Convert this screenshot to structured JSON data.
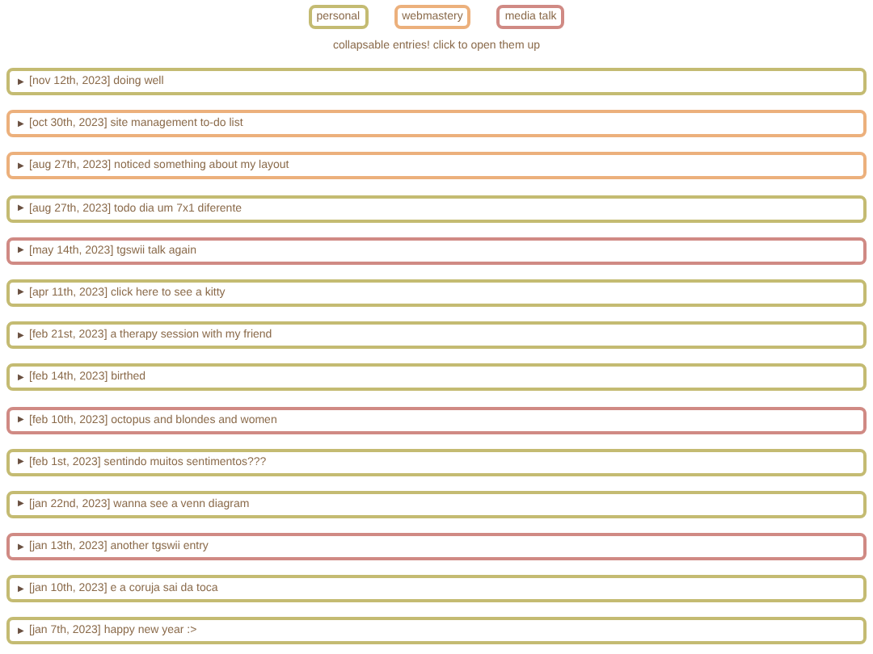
{
  "tags": [
    {
      "label": "personal",
      "color": "#c4bb72"
    },
    {
      "label": "webmastery",
      "color": "#ecb07c"
    },
    {
      "label": "media talk",
      "color": "#d08a84"
    }
  ],
  "subtitle": "collapsable entries! click to open them up",
  "entries": [
    {
      "marker": "▶",
      "title": "[nov 12th, 2023] doing well",
      "color": "#c4bb72",
      "expanded": false
    },
    {
      "marker": "▶",
      "title": "[oct 30th, 2023] site management to-do list",
      "color": "#ecb07c",
      "expanded": false
    },
    {
      "marker": "▶",
      "title": "[aug 27th, 2023] noticed something about my layout",
      "color": "#ecb07c",
      "expanded": false
    },
    {
      "marker": "▶",
      "title": "[aug 27th, 2023] todo dia um 7x1 diferente",
      "color": "#c4bb72",
      "expanded": false
    },
    {
      "marker": "▶",
      "title": "[may 14th, 2023] tgswii talk again",
      "color": "#d08a84",
      "expanded": false
    },
    {
      "marker": "▶",
      "title": "[apr 11th, 2023] click here to see a kitty",
      "color": "#c4bb72",
      "expanded": false
    },
    {
      "marker": "▶",
      "title": "[feb 21st, 2023] a therapy session with my friend",
      "color": "#c4bb72",
      "expanded": false
    },
    {
      "marker": "▶",
      "title": "[feb 14th, 2023] birthed",
      "color": "#c4bb72",
      "expanded": false
    },
    {
      "marker": "▶",
      "title": "[feb 10th, 2023] octopus and blondes and women",
      "color": "#d08a84",
      "expanded": false
    },
    {
      "marker": "▶",
      "title": "[feb 1st, 2023] sentindo muitos sentimentos???",
      "color": "#c4bb72",
      "expanded": false
    },
    {
      "marker": "▶",
      "title": "[jan 22nd, 2023] wanna see a venn diagram",
      "color": "#c4bb72",
      "expanded": false
    },
    {
      "marker": "▶",
      "title": "[jan 13th, 2023] another tgswii entry",
      "color": "#d08a84",
      "expanded": false
    },
    {
      "marker": "▶",
      "title": "[jan 10th, 2023] e a coruja sai da toca",
      "color": "#c4bb72",
      "expanded": false
    },
    {
      "marker": "▶",
      "title": "[jan 7th, 2023] happy new year :>",
      "color": "#c4bb72",
      "expanded": false
    }
  ]
}
